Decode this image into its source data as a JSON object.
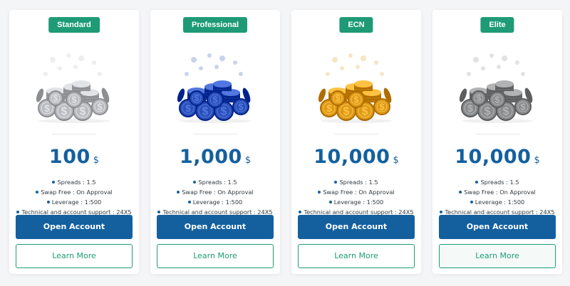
{
  "plans": [
    {
      "name": "Standard",
      "coin_color": "silver",
      "amount": "100",
      "currency": "$",
      "features": [
        "Spreads : 1.5",
        "Swap Free : On Approval",
        "Leverage : 1:500",
        "Technical and account support : 24X5"
      ],
      "open_label": "Open Account",
      "learn_label": "Learn More"
    },
    {
      "name": "Professional",
      "coin_color": "blue",
      "amount": "1,000",
      "currency": "$",
      "features": [
        "Spreads : 1.5",
        "Swap Free : On Approval",
        "Leverage : 1:500",
        "Technical and account support : 24X5"
      ],
      "open_label": "Open Account",
      "learn_label": "Learn More"
    },
    {
      "name": "ECN",
      "coin_color": "gold",
      "amount": "10,000",
      "currency": "$",
      "features": [
        "Spreads : 1.5",
        "Swap Free : On Approval",
        "Leverage : 1:500",
        "Technical and account support : 24X5"
      ],
      "open_label": "Open Account",
      "learn_label": "Learn More"
    },
    {
      "name": "Elite",
      "coin_color": "gray",
      "amount": "10,000",
      "currency": "$",
      "features": [
        "Spreads : 1.5",
        "Swap Free : On Approval",
        "Leverage : 1:500",
        "Technical and account support : 24X5"
      ],
      "open_label": "Open Account",
      "learn_label": "Learn More"
    }
  ],
  "colors": {
    "badge": "#1e9b76",
    "price": "#14609f",
    "primary_button": "#14609f",
    "outline_button": "#1e9b76",
    "coin_silver": "#b9bbbe",
    "coin_blue": "#2a4fb8",
    "coin_gold": "#dd9a1a",
    "coin_gray": "#8a8b8d"
  },
  "icons": {
    "coins": "coin-stack-icon",
    "bullet": "bullet-dot-icon"
  }
}
